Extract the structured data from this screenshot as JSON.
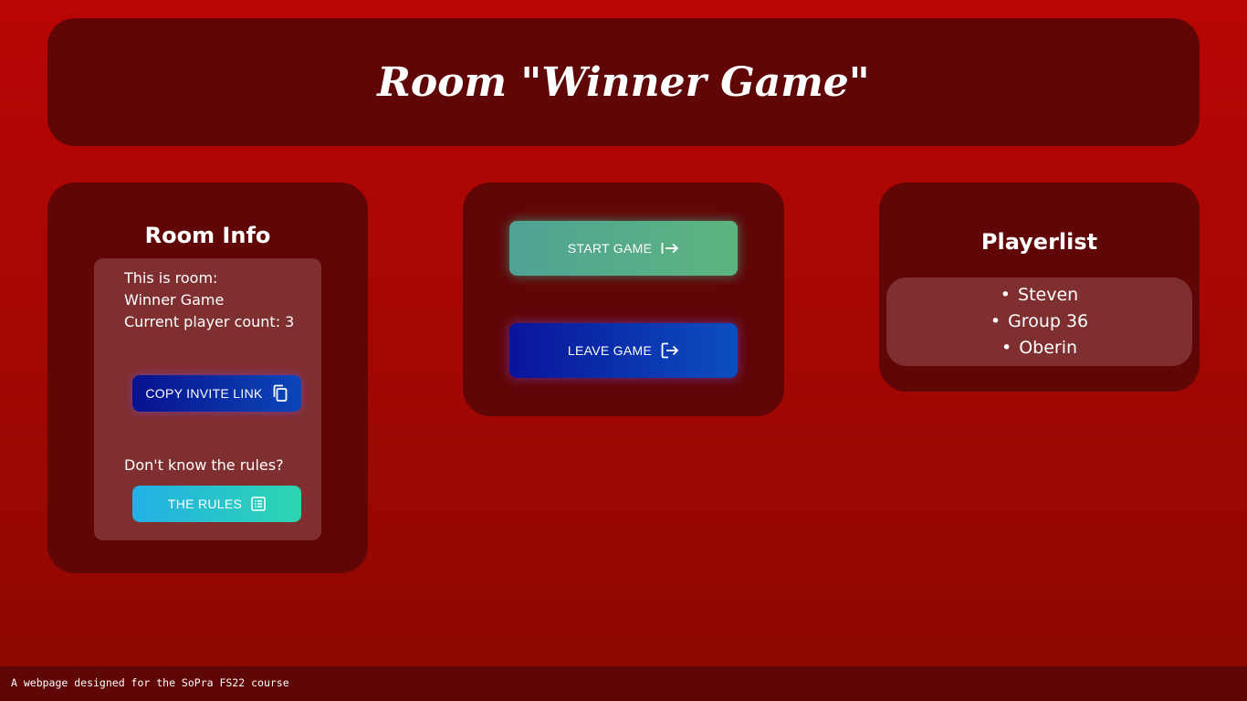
{
  "header": {
    "title": "Room \"Winner Game\""
  },
  "room_info": {
    "heading": "Room Info",
    "line1": "This is room:",
    "room_name": "Winner Game",
    "player_count": "Current player count: 3",
    "copy_invite_label": "COPY INVITE LINK",
    "rules_prompt": "Don't know the rules?",
    "rules_label": "THE RULES"
  },
  "actions": {
    "start_label": "START GAME",
    "leave_label": "LEAVE GAME"
  },
  "playerlist": {
    "heading": "Playerlist",
    "players": [
      "Steven",
      "Group 36",
      "Oberin"
    ]
  },
  "icons": {
    "copy": "copy-icon",
    "rules": "list-icon",
    "start": "arrow-right-to-bar-icon",
    "leave": "logout-icon"
  },
  "colors": {
    "background_top": "#b80604",
    "background_bottom": "#8c0900",
    "panel": "#610607",
    "inner_box": "#802f31",
    "start_button": "#5db57e",
    "leave_button": "#0b46b8",
    "rules_button": "#2ed6b0"
  },
  "footer": {
    "text": "A webpage designed for the SoPra FS22 course"
  }
}
